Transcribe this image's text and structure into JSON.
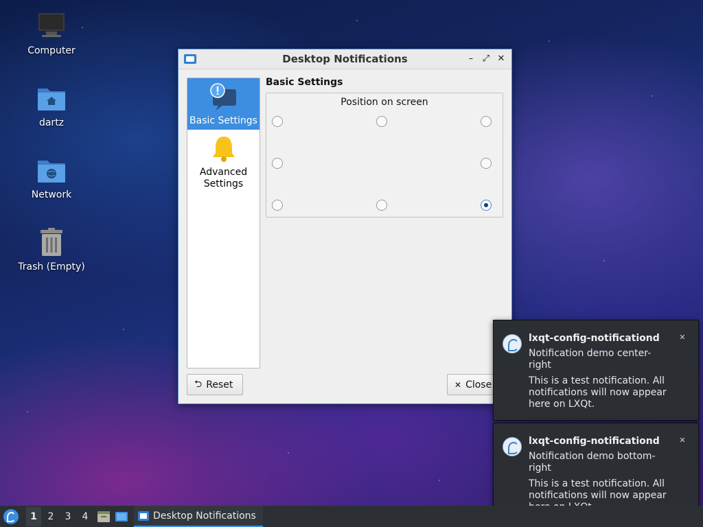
{
  "desktop": {
    "icons": [
      {
        "label": "Computer"
      },
      {
        "label": "dartz"
      },
      {
        "label": "Network"
      },
      {
        "label": "Trash (Empty)"
      }
    ]
  },
  "window": {
    "title": "Desktop Notifications",
    "controls": {
      "minimize": "–",
      "maximize": "⤢",
      "close": "✕"
    },
    "sidebar": [
      {
        "label": "Basic Settings",
        "active": true,
        "icon": "notification-icon"
      },
      {
        "label": "Advanced Settings",
        "active": false,
        "icon": "bell-icon"
      }
    ],
    "section_title": "Basic Settings",
    "position_group": {
      "legend": "Position on screen",
      "options": [
        "top-left",
        "top-center",
        "top-right",
        "center-left",
        "center-right",
        "bottom-left",
        "bottom-center",
        "bottom-right"
      ],
      "selected": "bottom-right"
    },
    "buttons": {
      "reset_icon": "⮌",
      "reset_label": "Reset",
      "close_icon": "✕",
      "close_label": "Close"
    }
  },
  "notifications": [
    {
      "app": "lxqt-config-notificationd",
      "summary": "Notification demo center-right",
      "body": "This is a test notification. All notifications will now appear here on LXQt.",
      "close": "✕"
    },
    {
      "app": "lxqt-config-notificationd",
      "summary": "Notification demo bottom-right",
      "body": "This is a test notification. All notifications will now appear here on LXQt.",
      "close": "✕"
    }
  ],
  "taskbar": {
    "desktops": [
      "1",
      "2",
      "3",
      "4"
    ],
    "active_desktop": "1",
    "task_label": "Desktop Notifications"
  },
  "colors": {
    "accent": "#3d8ee0",
    "notification_bg": "#2b2f33",
    "taskbar_bg": "#2c3035"
  }
}
